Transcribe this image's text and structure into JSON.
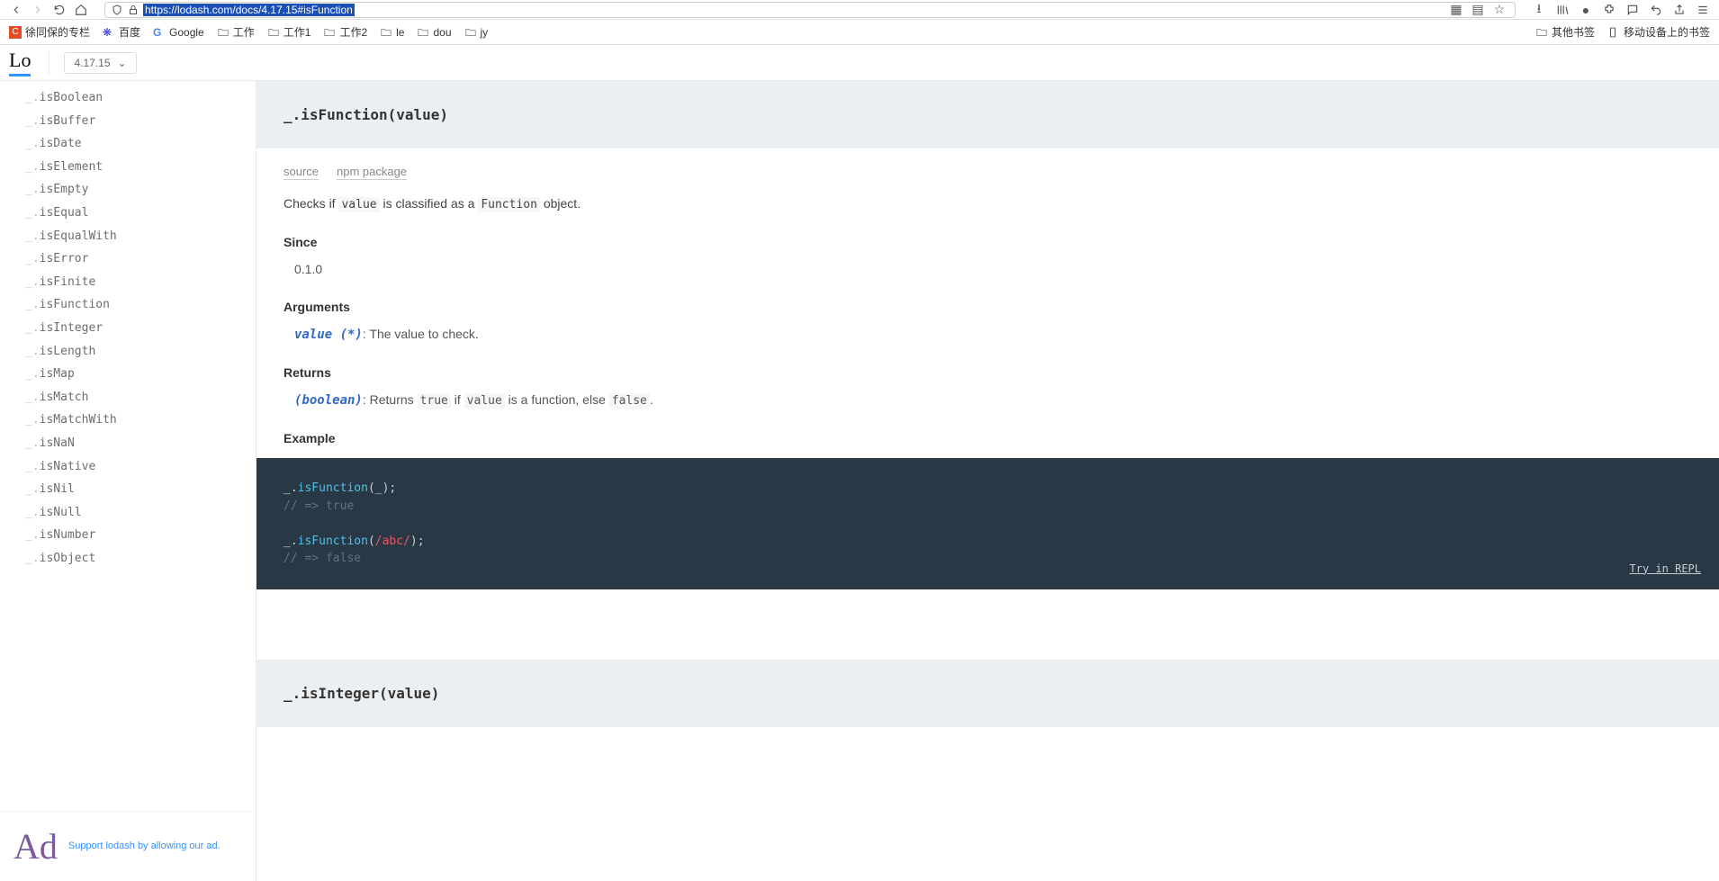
{
  "browser": {
    "url": "https://lodash.com/docs/4.17.15#isFunction",
    "bookmarks_left": [
      {
        "label": "徐同保的专栏",
        "type": "site",
        "color": "#e34c26"
      },
      {
        "label": "百度",
        "type": "baidu"
      },
      {
        "label": "Google",
        "type": "google"
      },
      {
        "label": "工作",
        "type": "folder"
      },
      {
        "label": "工作1",
        "type": "folder"
      },
      {
        "label": "工作2",
        "type": "folder"
      },
      {
        "label": "le",
        "type": "folder"
      },
      {
        "label": "dou",
        "type": "folder"
      },
      {
        "label": "jy",
        "type": "folder"
      }
    ],
    "bookmarks_right": [
      {
        "label": "其他书签",
        "type": "folder"
      },
      {
        "label": "移动设备上的书签",
        "type": "mobile"
      }
    ]
  },
  "header": {
    "logo": "Lo",
    "version": "4.17.15"
  },
  "sidebar": {
    "items": [
      {
        "prefix": "_.",
        "name": "isBoolean"
      },
      {
        "prefix": "_.",
        "name": "isBuffer"
      },
      {
        "prefix": "_.",
        "name": "isDate"
      },
      {
        "prefix": "_.",
        "name": "isElement"
      },
      {
        "prefix": "_.",
        "name": "isEmpty"
      },
      {
        "prefix": "_.",
        "name": "isEqual"
      },
      {
        "prefix": "_.",
        "name": "isEqualWith"
      },
      {
        "prefix": "_.",
        "name": "isError"
      },
      {
        "prefix": "_.",
        "name": "isFinite"
      },
      {
        "prefix": "_.",
        "name": "isFunction"
      },
      {
        "prefix": "_.",
        "name": "isInteger"
      },
      {
        "prefix": "_.",
        "name": "isLength"
      },
      {
        "prefix": "_.",
        "name": "isMap"
      },
      {
        "prefix": "_.",
        "name": "isMatch"
      },
      {
        "prefix": "_.",
        "name": "isMatchWith"
      },
      {
        "prefix": "_.",
        "name": "isNaN"
      },
      {
        "prefix": "_.",
        "name": "isNative"
      },
      {
        "prefix": "_.",
        "name": "isNil"
      },
      {
        "prefix": "_.",
        "name": "isNull"
      },
      {
        "prefix": "_.",
        "name": "isNumber"
      },
      {
        "prefix": "_.",
        "name": "isObject"
      }
    ]
  },
  "ad": {
    "title": "Ad",
    "desc": "Support lodash by allowing our ad."
  },
  "method": {
    "signature": "_.isFunction(value)",
    "meta": {
      "source": "source",
      "npm": "npm package"
    },
    "description_pre": "Checks if ",
    "description_code1": "value",
    "description_mid": " is classified as a ",
    "description_code2": "Function",
    "description_post": " object.",
    "since_label": "Since",
    "since_value": "0.1.0",
    "arguments_label": "Arguments",
    "arg_name": "value (*)",
    "arg_desc": ": The value to check.",
    "returns_label": "Returns",
    "ret_type": "(boolean)",
    "ret_desc_pre": ": Returns ",
    "ret_true": "true",
    "ret_mid": " if ",
    "ret_value": "value",
    "ret_mid2": " is a function, else ",
    "ret_false": "false",
    "ret_post": ".",
    "example_label": "Example",
    "code": {
      "l1_var": "_",
      "l1_dot": ".",
      "l1_method": "isFunction",
      "l1_rest": "(_);",
      "l2": "// => true",
      "l3_var": "_",
      "l3_dot": ".",
      "l3_method": "isFunction",
      "l3_open": "(",
      "l3_regex": "/abc/",
      "l3_close": ");",
      "l4": "// => false"
    },
    "repl": "Try in REPL"
  },
  "next_method": {
    "signature": "_.isInteger(value)"
  }
}
